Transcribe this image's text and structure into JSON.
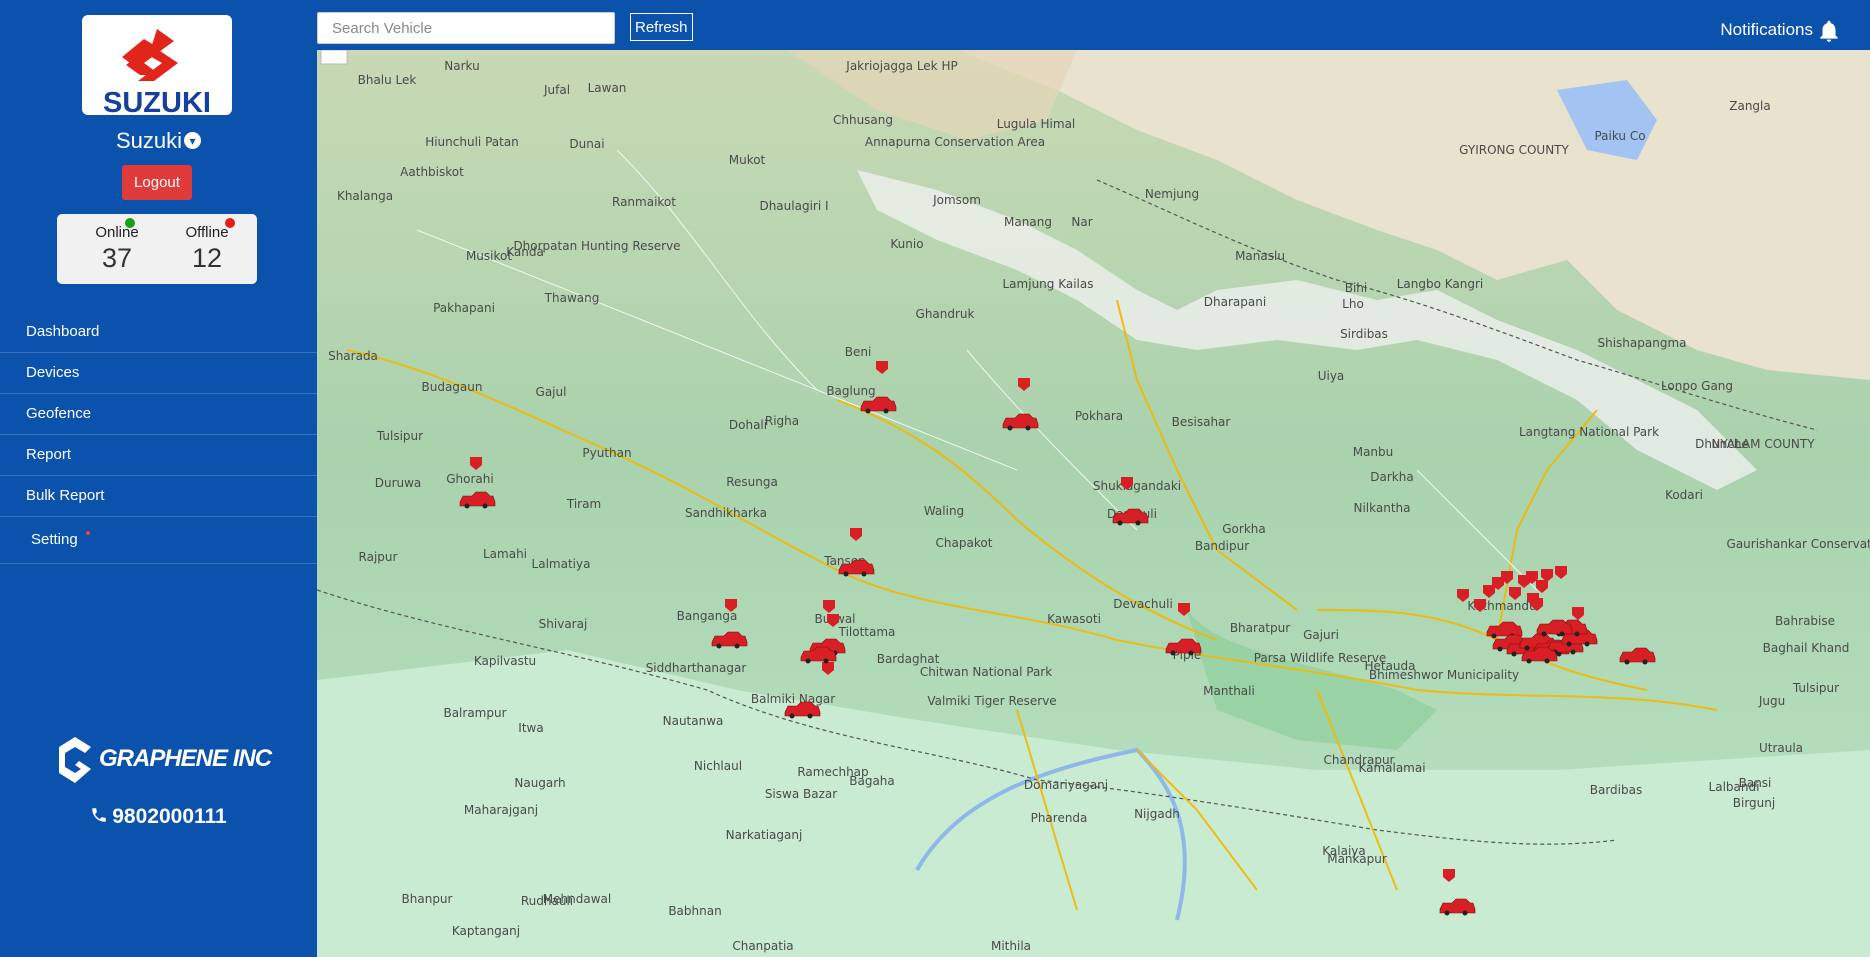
{
  "sidebar": {
    "logo_text": "SUZUKI",
    "user_name": "Suzuki",
    "logout_label": "Logout",
    "status": {
      "online_label": "Online",
      "online_count": "37",
      "offline_label": "Offline",
      "offline_count": "12",
      "online_color": "#15a015",
      "offline_color": "#e51b1b"
    },
    "nav": [
      "Dashboard",
      "Devices",
      "Geofence",
      "Report",
      "Bulk Report",
      "Setting"
    ],
    "brand_text": "GRAPHENE INC",
    "phone": "9802000111"
  },
  "topbar": {
    "search_placeholder": "Search Vehicle",
    "refresh_label": "Refresh",
    "notifications_label": "Notifications"
  },
  "map": {
    "places": [
      "Bhalu Lek",
      "Narku",
      "Jakriojagga Lek HP",
      "Jufal",
      "Lawan",
      "Hiunchuli Patan",
      "Dunai",
      "Chhusang",
      "Lugula Himal",
      "Annapurna Conservation Area",
      "GYIRONG COUNTY",
      "Paiku Co",
      "Zangla",
      "Aathbiskot",
      "Mukot",
      "Khalanga",
      "Ranmaikot",
      "Dhaulagiri I",
      "Jomsom",
      "Nemjung",
      "Musikot",
      "Kanda",
      "Dhorpatan Hunting Reserve",
      "Kunio",
      "Manang",
      "Nar",
      "Manaslu",
      "Bihi",
      "Langbo Kangri",
      "Thawang",
      "Pakhapani",
      "Lamjung Kailas",
      "Ghandruk",
      "Dharapani",
      "Lho",
      "Sirdibas",
      "Sharada",
      "Beni",
      "Budagaun",
      "Gajul",
      "Baglung",
      "Shishapangma",
      "Pokhara",
      "Besisahar",
      "Uiya",
      "Langtang National Park",
      "Lonpo Gang",
      "Dohali",
      "Righa",
      "Manbu",
      "Tulsipur",
      "Duruwa",
      "Ghorahi",
      "Pyuthan",
      "Resunga",
      "Shuklagandaki",
      "Darkha",
      "Dhunche",
      "NYALAM COUNTY",
      "Tiram",
      "Sandhikharka",
      "Waling",
      "Damauli",
      "Gorkha",
      "Kodari",
      "Lamahi",
      "Rajpur",
      "Lalmatiya",
      "Tansen",
      "Chapakot",
      "Bandipur",
      "Nilkantha",
      "Gaurishankar Conservation Area",
      "Shivaraj",
      "Banganga",
      "Butwal",
      "Tilottama",
      "Devachuli",
      "Kawasoti",
      "Bharatpur",
      "Gajuri",
      "Kathmandu",
      "Bahrabise",
      "Baghail Khand",
      "Kapilvastu",
      "Siddharthanagar",
      "Bardaghat",
      "Chitwan National Park",
      "Piple",
      "Parsa Wildlife Reserve",
      "Hetauda",
      "Bhimeshwor Municipality",
      "Jugu",
      "Tulsipur",
      "Balrampur",
      "Itwa",
      "Nautanwa",
      "Balmiki Nagar",
      "Valmiki Tiger Reserve",
      "Manthali",
      "Utraula",
      "Naugarh",
      "Nichlaul",
      "Ramechhap",
      "Domariyaganj",
      "Bansi",
      "Maharajganj",
      "Siswa Bazar",
      "Bagaha",
      "Pharenda",
      "Narkatiaganj",
      "Nijgadh",
      "Chandrapur",
      "Kamalamai",
      "Lalbandi",
      "Bardibas",
      "Birgunj",
      "Kalaiya",
      "Mankapur",
      "Bhanpur",
      "Rudhauli",
      "Mehndawal",
      "Babhnan",
      "Kaptanganj",
      "Chanpatia",
      "Mithila"
    ]
  }
}
